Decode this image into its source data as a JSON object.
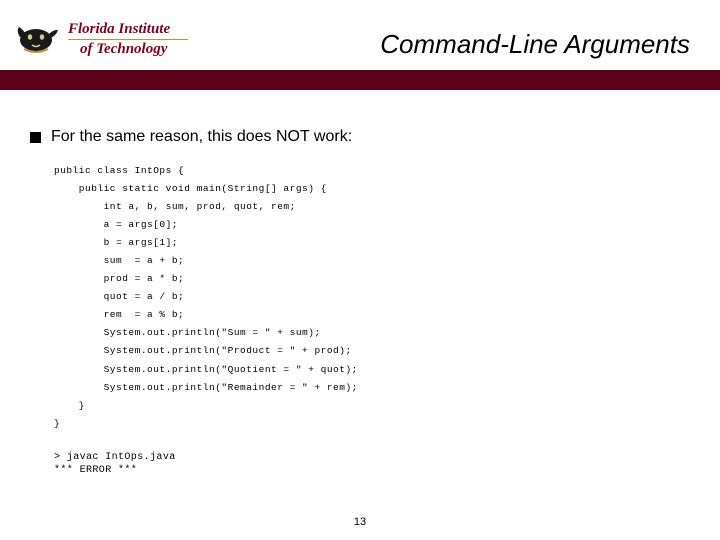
{
  "logo": {
    "line1": "Florida Institute",
    "line2": "of Technology"
  },
  "title": "Command-Line Arguments",
  "bullet": "For the same reason, this does NOT work:",
  "code": "public class IntOps {\n    public static void main(String[] args) {\n        int a, b, sum, prod, quot, rem;\n        a = args[0];\n        b = args[1];\n        sum  = a + b;\n        prod = a * b;\n        quot = a / b;\n        rem  = a % b;\n        System.out.println(\"Sum = \" + sum);\n        System.out.println(\"Product = \" + prod);\n        System.out.println(\"Quotient = \" + quot);\n        System.out.println(\"Remainder = \" + rem);\n    }\n}",
  "output": "> javac IntOps.java\n*** ERROR ***",
  "page_number": "13"
}
